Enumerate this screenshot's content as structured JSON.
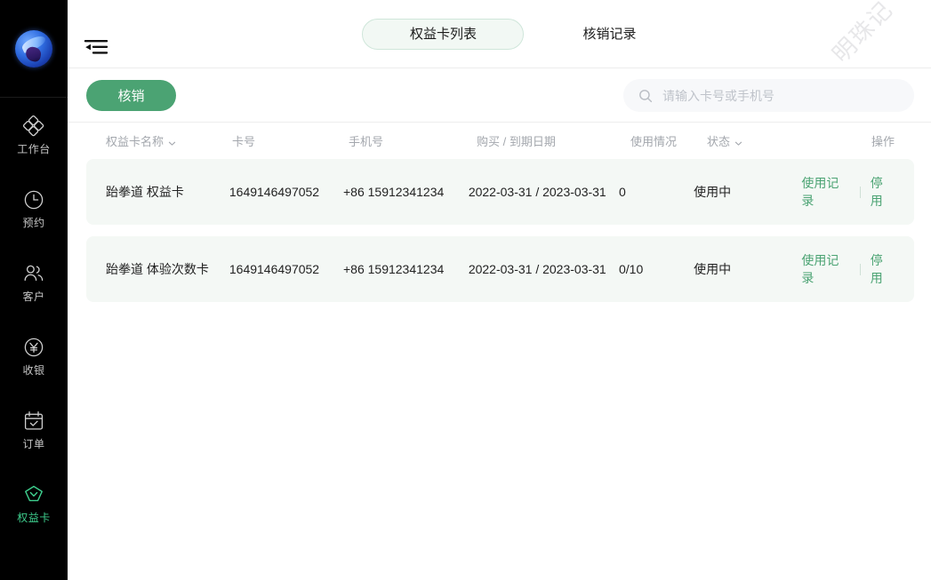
{
  "sidebar": {
    "logo_name": "app-logo",
    "items": [
      {
        "label": "工作台",
        "icon": "workbench-icon",
        "active": false
      },
      {
        "label": "预约",
        "icon": "clock-icon",
        "active": false
      },
      {
        "label": "客户",
        "icon": "users-icon",
        "active": false
      },
      {
        "label": "收银",
        "icon": "cashier-icon",
        "active": false
      },
      {
        "label": "订单",
        "icon": "calendar-check-icon",
        "active": false
      },
      {
        "label": "权益卡",
        "icon": "membership-card-icon",
        "active": true
      }
    ]
  },
  "topbar": {
    "collapse_icon": "collapse-sidebar-icon",
    "tabs": [
      {
        "label": "权益卡列表",
        "active": true
      },
      {
        "label": "核销记录",
        "active": false
      }
    ]
  },
  "toolbar": {
    "primary_button": "核销",
    "search": {
      "placeholder": "请输入卡号或手机号",
      "value": "",
      "icon": "search-icon"
    }
  },
  "watermark": {
    "text": "明珠记"
  },
  "table": {
    "columns": [
      {
        "label": "权益卡名称",
        "sortable": true
      },
      {
        "label": "卡号",
        "sortable": false
      },
      {
        "label": "手机号",
        "sortable": false
      },
      {
        "label": "购买 / 到期日期",
        "sortable": false
      },
      {
        "label": "使用情况",
        "sortable": false
      },
      {
        "label": "状态",
        "sortable": true
      },
      {
        "label": "操作",
        "sortable": false
      }
    ],
    "rows": [
      {
        "name": "跆拳道 权益卡",
        "card_no": "1649146497052",
        "phone": "+86 15912341234",
        "dates": "2022-03-31 / 2023-03-31",
        "usage": "0",
        "status": "使用中",
        "op_records": "使用记录",
        "op_disable": "停用"
      },
      {
        "name": "跆拳道 体验次数卡",
        "card_no": "1649146497052",
        "phone": "+86 15912341234",
        "dates": "2022-03-31 / 2023-03-31",
        "usage": "0/10",
        "status": "使用中",
        "op_records": "使用记录",
        "op_disable": "停用"
      }
    ]
  },
  "colors": {
    "accent_green": "#4ba373",
    "active_nav_green": "#3ecf8e",
    "row_bg": "#f4f8f5",
    "sidebar_bg": "#000000",
    "tab_active_bg": "#f2f8f4"
  }
}
